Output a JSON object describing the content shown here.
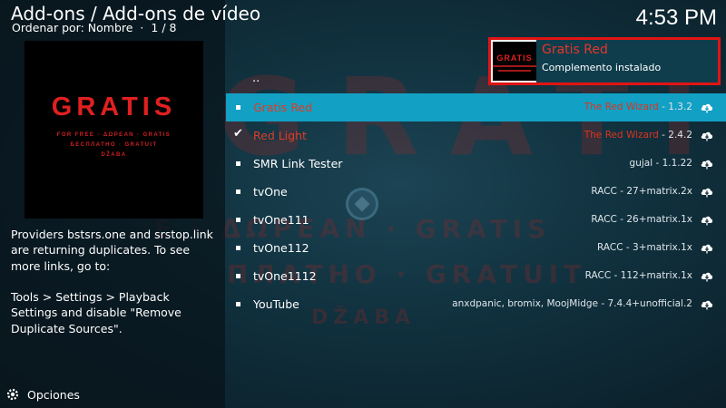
{
  "header": {
    "title": "Add-ons / Add-ons de vídeo",
    "sort_label": "Ordenar por: Nombre",
    "page_indicator": "1 / 8",
    "clock": "4:53 PM"
  },
  "thumbnail": {
    "title": "GRATIS",
    "line1": "FOR FREE · ΔΩΡΕΑΝ · GRATIS",
    "line2": "БЕСПЛАТНО · GRATUIT",
    "line3": "DŽABA"
  },
  "description": "Providers bstsrs.one and srstop.link are returning duplicates. To see more links, go to:\n\nTools > Settings > Playback Settings and disable \"Remove Duplicate Sources\".",
  "footer": {
    "options_label": "Opciones",
    "options_icon": "gear-icon"
  },
  "list": {
    "parent_label": "..",
    "items": [
      {
        "name": "Gratis Red",
        "author": "The Red Wizard",
        "version": "1.3.2",
        "icon": "download-cloud-icon",
        "selected": true,
        "marker": "bullet"
      },
      {
        "name": "Red Light",
        "author": "The Red Wizard",
        "version": "2.4.2",
        "icon": "download-cloud-icon",
        "selected": false,
        "marker": "check"
      },
      {
        "name": "SMR Link Tester",
        "author": "gujal",
        "version": "1.1.22",
        "icon": "download-cloud-icon",
        "selected": false,
        "marker": "bullet"
      },
      {
        "name": "tvOne",
        "author": "RACC",
        "version": "27+matrix.2x",
        "icon": "download-cloud-icon",
        "selected": false,
        "marker": "bullet"
      },
      {
        "name": "tvOne111",
        "author": "RACC",
        "version": "26+matrix.1x",
        "icon": "download-cloud-icon",
        "selected": false,
        "marker": "bullet"
      },
      {
        "name": "tvOne112",
        "author": "RACC",
        "version": "3+matrix.1x",
        "icon": "download-cloud-icon",
        "selected": false,
        "marker": "bullet"
      },
      {
        "name": "tvOne1112",
        "author": "RACC",
        "version": "112+matrix.1x",
        "icon": "download-cloud-icon",
        "selected": false,
        "marker": "bullet"
      },
      {
        "name": "YouTube",
        "author": "anxdpanic, bromix, MoojMidge",
        "version": "7.4.4+unofficial.2",
        "icon": "download-cloud-icon",
        "selected": false,
        "marker": "bullet"
      }
    ]
  },
  "notification": {
    "title": "Gratis Red",
    "message": "Complemento instalado",
    "image_text": "GRATIS",
    "border_color": "#e11414"
  },
  "background_text": {
    "big": "GRATIS",
    "line1": "E · ΔΩΡΕΑΝ · GRATIS",
    "line2": "ПЛАТНО · GRATUIT",
    "line3": "DŽABA"
  },
  "colors": {
    "accent_selected": "#12a0c4",
    "addon_red": "#e43a26"
  }
}
